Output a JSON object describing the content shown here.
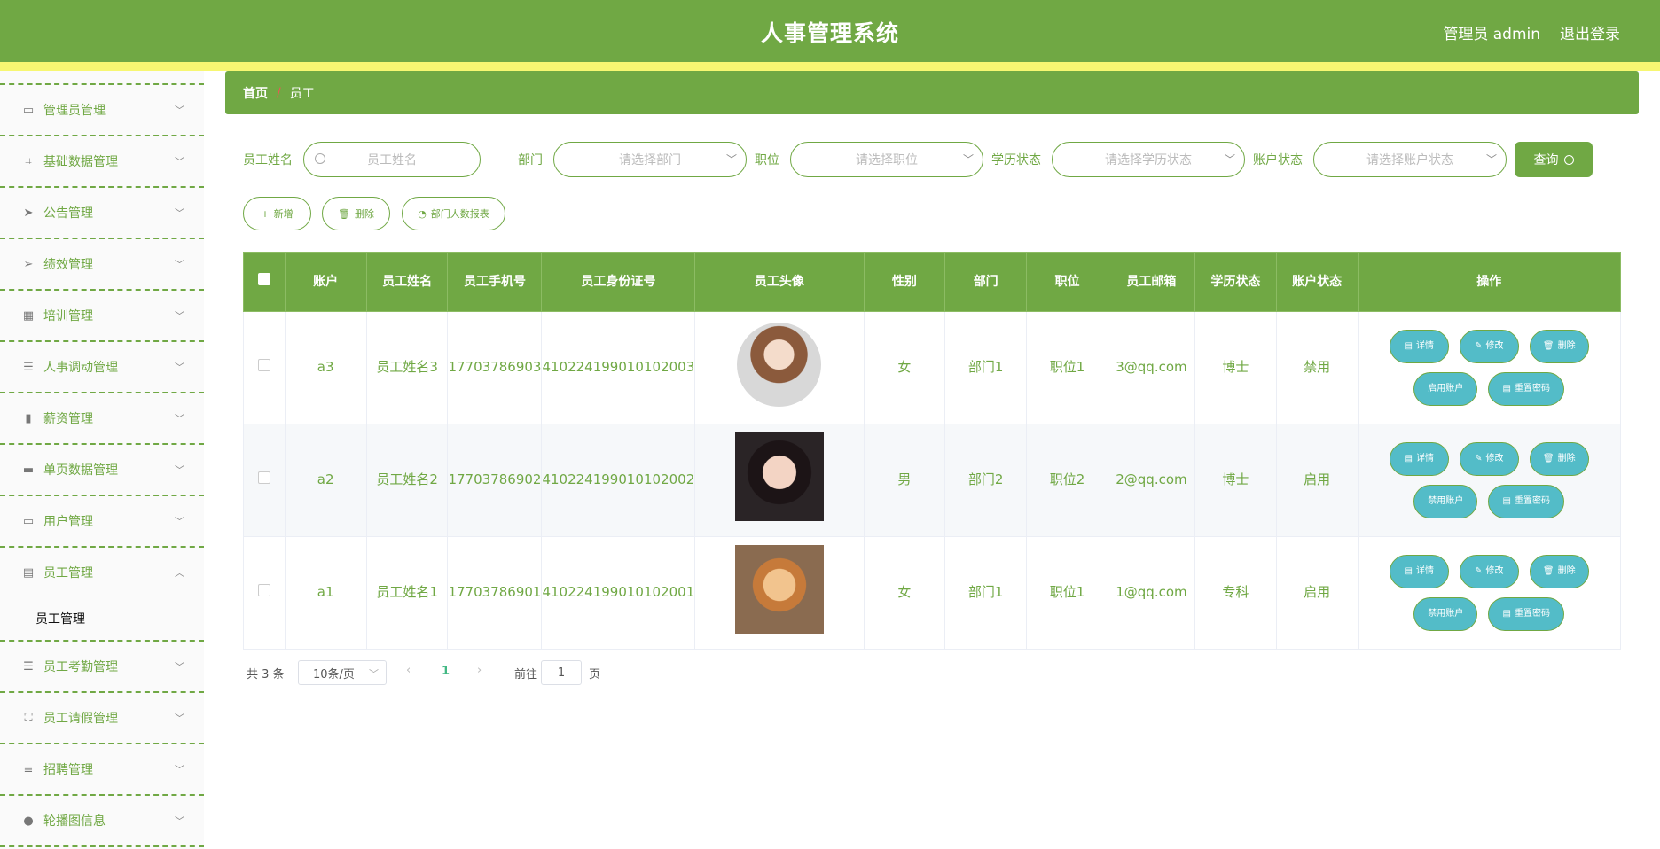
{
  "header": {
    "title": "人事管理系统",
    "user": "管理员 admin",
    "logout": "退出登录"
  },
  "sidebar": {
    "items": [
      {
        "label": "管理员管理",
        "icon": "id-card-icon"
      },
      {
        "label": "基础数据管理",
        "icon": "crop-icon"
      },
      {
        "label": "公告管理",
        "icon": "send-icon"
      },
      {
        "label": "绩效管理",
        "icon": "navigation-icon"
      },
      {
        "label": "培训管理",
        "icon": "grid-icon"
      },
      {
        "label": "人事调动管理",
        "icon": "sliders-icon"
      },
      {
        "label": "薪资管理",
        "icon": "library-icon"
      },
      {
        "label": "单页数据管理",
        "icon": "chat-icon"
      },
      {
        "label": "用户管理",
        "icon": "monitor-icon"
      },
      {
        "label": "员工管理",
        "icon": "wallet-icon"
      },
      {
        "label": "员工考勤管理",
        "icon": "list-icon"
      },
      {
        "label": "员工请假管理",
        "icon": "frame-icon"
      },
      {
        "label": "招聘管理",
        "icon": "menu-icon"
      },
      {
        "label": "轮播图信息",
        "icon": "user-icon"
      }
    ],
    "submenu": "员工管理"
  },
  "breadcrumb": {
    "home": "首页",
    "sep": "/",
    "current": "员工"
  },
  "search": {
    "name_label": "员工姓名",
    "name_placeholder": "员工姓名",
    "dept_label": "部门",
    "dept_placeholder": "请选择部门",
    "pos_label": "职位",
    "pos_placeholder": "请选择职位",
    "edu_label": "学历状态",
    "edu_placeholder": "请选择学历状态",
    "acct_label": "账户状态",
    "acct_placeholder": "请选择账户状态",
    "query": "查询"
  },
  "actions": {
    "add": "新增",
    "delete": "删除",
    "report": "部门人数报表"
  },
  "table": {
    "columns": [
      "账户",
      "员工姓名",
      "员工手机号",
      "员工身份证号",
      "员工头像",
      "性别",
      "部门",
      "职位",
      "员工邮箱",
      "学历状态",
      "账户状态",
      "操作"
    ],
    "rows": [
      {
        "account": "a3",
        "name": "员工姓名3",
        "phone": "17703786903",
        "idcard": "410224199010102003",
        "avatar": "cartoon-girl-avatar",
        "gender": "女",
        "dept": "部门1",
        "pos": "职位1",
        "email": "3@qq.com",
        "edu": "博士",
        "status": "禁用",
        "toggle": "启用账户"
      },
      {
        "account": "a2",
        "name": "员工姓名2",
        "phone": "17703786902",
        "idcard": "410224199010102002",
        "avatar": "woman-photo-avatar",
        "gender": "男",
        "dept": "部门2",
        "pos": "职位2",
        "email": "2@qq.com",
        "edu": "博士",
        "status": "启用",
        "toggle": "禁用账户"
      },
      {
        "account": "a1",
        "name": "员工姓名1",
        "phone": "17703786901",
        "idcard": "410224199010102001",
        "avatar": "shiba-dog-avatar",
        "gender": "女",
        "dept": "部门1",
        "pos": "职位1",
        "email": "1@qq.com",
        "edu": "专科",
        "status": "启用",
        "toggle": "禁用账户"
      }
    ],
    "ops": {
      "detail": "详情",
      "edit": "修改",
      "delete": "删除",
      "reset": "重置密码"
    }
  },
  "pagination": {
    "total": "共 3 条",
    "size": "10条/页",
    "page": "1",
    "goto": "前往",
    "goto_value": "1",
    "page_unit": "页"
  },
  "colors": {
    "primary": "#70a844",
    "stripe": "#f7f772",
    "op_button": "#53bcc8"
  }
}
